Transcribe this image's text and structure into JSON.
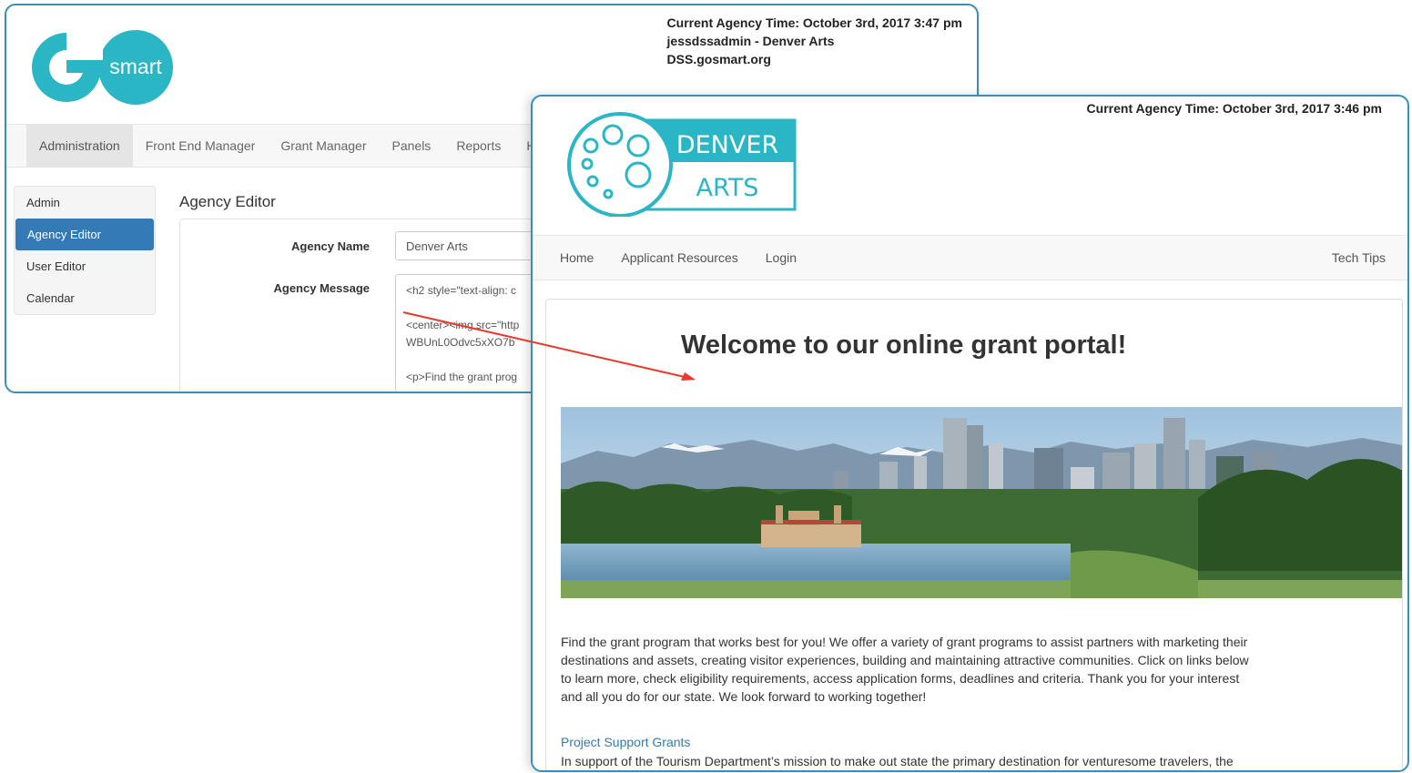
{
  "admin": {
    "logo_letter": "G",
    "logo_word": "smart",
    "header_time": "Current Agency Time: October 3rd, 2017 3:47 pm",
    "header_user": "jessdssadmin - Denver Arts",
    "header_site": "DSS.gosmart.org",
    "nav": [
      "Administration",
      "Front End Manager",
      "Grant Manager",
      "Panels",
      "Reports",
      "Help"
    ],
    "sidebar": [
      "Admin",
      "Agency Editor",
      "User Editor",
      "Calendar"
    ],
    "page_title": "Agency Editor",
    "agency_name_label": "Agency Name",
    "agency_name_value": "Denver Arts",
    "agency_message_label": "Agency Message",
    "agency_message_value": "<h2 style=\"text-align: c\n\n<center><img src=\"http\nWBUnL0Odvc5xXO7b\n\n<p>Find the grant prog"
  },
  "portal": {
    "header_time": "Current Agency Time: October 3rd, 2017 3:46 pm",
    "logo_line1": "DENVER",
    "logo_line2": "ARTS",
    "nav": [
      "Home",
      "Applicant Resources",
      "Login"
    ],
    "nav_right": "Tech Tips",
    "welcome": "Welcome to our online grant portal!",
    "intro": "Find the grant program that works best for you! We offer a variety of grant programs to assist partners with marketing their destinations and assets, creating visitor experiences, building and maintaining attractive communities. Click on links below to learn more, check eligibility requirements, access application forms, deadlines and criteria. Thank you for your interest and all you do for our state. We look forward to working together!",
    "program_link": "Project Support Grants",
    "program_desc": "In support of the Tourism Department’s mission to make out state the primary destination for venturesome travelers, the"
  },
  "colors": {
    "teal": "#2bb6c6",
    "window_border": "#3a8fb7",
    "active_blue": "#337ab7",
    "link_blue": "#337ab7",
    "arrow_red": "#e8392c"
  }
}
